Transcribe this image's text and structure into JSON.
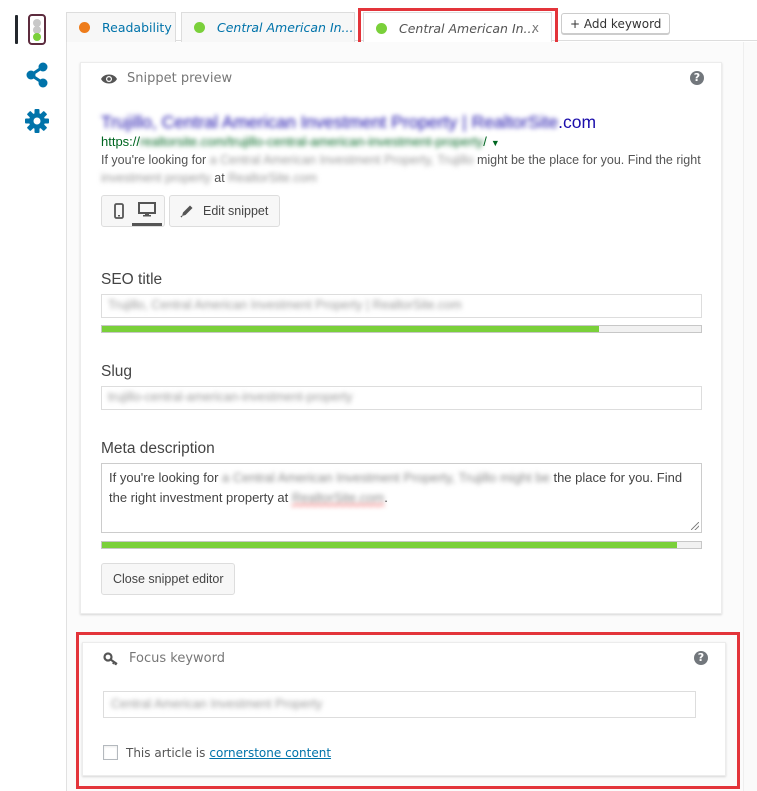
{
  "sidebar": {
    "icons": [
      {
        "name": "traffic-light-icon",
        "status_color": "#7ad03a",
        "active": true
      },
      {
        "name": "share-icon",
        "color": "#0073aa"
      },
      {
        "name": "gear-icon",
        "color": "#0073aa"
      }
    ]
  },
  "tabs": [
    {
      "label": "Readability",
      "status_color": "#ee7c1b",
      "active": false
    },
    {
      "label": "Central American In...",
      "status_color": "#7ad03a",
      "active": false
    },
    {
      "label": "Central American In...",
      "status_color": "#7ad03a",
      "active": true,
      "close_label": "x"
    }
  ],
  "add_keyword_label": "+ Add keyword",
  "snippet": {
    "header": "Snippet preview",
    "help_label": "?",
    "serp_title_blurred": "Trujillo, Central American Investment Property |",
    "serp_title_blurred_domain": "RealtorSite",
    "serp_title_suffix": ".com",
    "serp_url_prefix": "https://",
    "serp_url_blurred": "realtorsite.com/trujillo-central-american-investment-property",
    "serp_url_suffix": "/",
    "serp_url_arrow": "▼",
    "serp_desc_part1": "If you're looking for ",
    "serp_desc_blur1": "a Central American Investment Property, Trujillo",
    "serp_desc_part2": " might be the place for you. Find the right ",
    "serp_desc_blur2": "investment property",
    "serp_desc_part3": " at ",
    "serp_desc_blur3": "RealtorSite.com",
    "edit_snippet_label": "Edit snippet",
    "seo_title_label": "SEO title",
    "seo_title_value": "Trujillo, Central American Investment Property | RealtorSite.com",
    "seo_title_score": 0.83,
    "slug_label": "Slug",
    "slug_value": "trujillo-central-american-investment-property",
    "meta_label": "Meta description",
    "meta_part1": "If you're looking for ",
    "meta_blur1": "a Central American Investment Property, Trujillo might be",
    "meta_part2": " the place for you. Find the right investment property at ",
    "meta_blur2": "RealtorSite.com",
    "meta_part3": ".",
    "meta_score": 0.96,
    "close_editor_label": "Close snippet editor"
  },
  "focus": {
    "header": "Focus keyword",
    "help_label": "?",
    "keyword_value": "Central American Investment Property",
    "cornerstone_prefix": "This article is",
    "cornerstone_link": "cornerstone content",
    "cornerstone_checked": false
  },
  "highlight_color": "#e3343a"
}
